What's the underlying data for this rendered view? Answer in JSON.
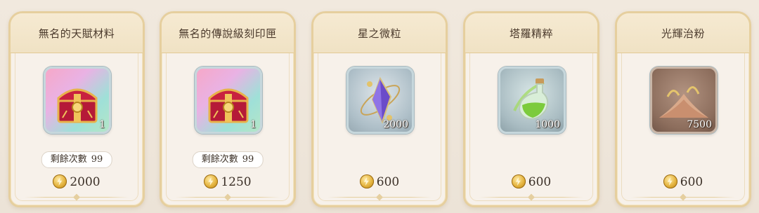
{
  "shop": {
    "items": [
      {
        "name": "無名的天賦材料",
        "icon": "treasure-chest-icon",
        "quantity": "1",
        "remaining_label": "剩餘次數",
        "remaining_count": "99",
        "price": "2000",
        "currency_icon": "gold-coin-icon"
      },
      {
        "name": "無名的傳說級刻印匣",
        "icon": "treasure-chest-icon",
        "quantity": "1",
        "remaining_label": "剩餘次數",
        "remaining_count": "99",
        "price": "1250",
        "currency_icon": "gold-coin-icon"
      },
      {
        "name": "星之微粒",
        "icon": "star-crystal-icon",
        "quantity": "2000",
        "price": "600",
        "currency_icon": "gold-coin-icon"
      },
      {
        "name": "塔羅精粹",
        "icon": "potion-flask-icon",
        "quantity": "1000",
        "price": "600",
        "currency_icon": "gold-coin-icon"
      },
      {
        "name": "光輝治粉",
        "icon": "sand-pile-icon",
        "quantity": "7500",
        "price": "600",
        "currency_icon": "gold-coin-icon"
      }
    ]
  },
  "colors": {
    "card_border": "#e6cf9e",
    "card_bg": "#f7f1ea",
    "text": "#3b3027"
  }
}
